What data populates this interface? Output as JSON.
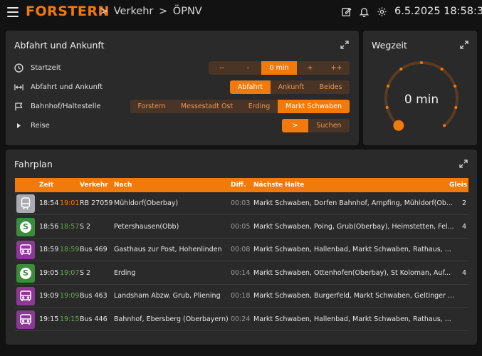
{
  "header": {
    "brand": "FORSTERN",
    "breadcrumb": [
      "Verkehr",
      "ÖPNV"
    ],
    "datetime": "6.5.2025 18:58:34",
    "icons": [
      "menu-icon",
      "pencil-icon",
      "bell-icon",
      "gear-icon"
    ]
  },
  "abfahrt_card": {
    "title": "Abfahrt und Ankunft",
    "rows": {
      "startzeit": {
        "label": "Startzeit",
        "options": [
          "--",
          "-",
          "0 min",
          "+",
          "++"
        ],
        "selected": "0 min"
      },
      "richtung": {
        "label": "Abfahrt und Ankunft",
        "options": [
          "Abfahrt",
          "Ankunft",
          "Beides"
        ],
        "selected": "Abfahrt"
      },
      "haltestelle": {
        "label": "Bahnhof/Haltestelle",
        "options": [
          "Forstern",
          "Messestadt Ost",
          "Erding",
          "Markt Schwaben"
        ],
        "selected": "Markt Schwaben"
      },
      "reise": {
        "label": "Reise",
        "go": ">",
        "search": "Suchen"
      }
    }
  },
  "wegzeit_card": {
    "title": "Wegzeit",
    "value": "0 min",
    "gauge_fraction": 0.0
  },
  "fahrplan": {
    "title": "Fahrplan",
    "columns": [
      "Zeit",
      "Verkehr",
      "Nach",
      "Diff.",
      "Nächste Halte",
      "Gleis"
    ],
    "rows": [
      {
        "type": "rail",
        "planned": "18:54",
        "actual": "19:01",
        "actual_status": "late",
        "line": "RB 27059",
        "destination": "Mühldorf(Oberbay)",
        "diff": "00:03",
        "stops": "Markt Schwaben, Dorfen Bahnhof, Ampfing, Mühldorf(Ob...",
        "track": "2"
      },
      {
        "type": "sbahn",
        "planned": "18:56",
        "actual": "18:57",
        "actual_status": "ontime",
        "line": "S 2",
        "destination": "Petershausen(Obb)",
        "diff": "00:05",
        "stops": "Markt Schwaben, Poing, Grub(Oberbay), Heimstetten, Fel...",
        "track": "4"
      },
      {
        "type": "bus",
        "planned": "18:59",
        "actual": "18:59",
        "actual_status": "ontime",
        "line": "Bus 469",
        "destination": "Gasthaus zur Post, Hohenlinden",
        "diff": "00:08",
        "stops": "Markt Schwaben, Hallenbad, Markt Schwaben, Rathaus, ...",
        "track": ""
      },
      {
        "type": "sbahn",
        "planned": "19:05",
        "actual": "19:07",
        "actual_status": "ontime",
        "line": "S 2",
        "destination": "Erding",
        "diff": "00:14",
        "stops": "Markt Schwaben, Ottenhofen(Oberbay), St Koloman, Auf...",
        "track": "4"
      },
      {
        "type": "bus",
        "planned": "19:09",
        "actual": "19:09",
        "actual_status": "ontime",
        "line": "Bus 463",
        "destination": "Landsham Abzw. Grub, Pliening",
        "diff": "00:18",
        "stops": "Markt Schwaben, Burgerfeld, Markt Schwaben, Geltinger ...",
        "track": ""
      },
      {
        "type": "bus",
        "planned": "19:15",
        "actual": "19:15",
        "actual_status": "ontime",
        "line": "Bus 446",
        "destination": "Bahnhof, Ebersberg (Oberbayern)",
        "diff": "00:24",
        "stops": "Markt Schwaben, Hallenbad, Markt Schwaben, Rathaus, ...",
        "track": ""
      }
    ]
  },
  "colors": {
    "accent": "#f07a0c",
    "card_bg": "#2a2a2a",
    "page_bg": "#121212",
    "sbahn": "#3c8d3a",
    "bus": "#8a3a94",
    "rail": "#a9abb0",
    "ontime": "#6aa84f"
  }
}
